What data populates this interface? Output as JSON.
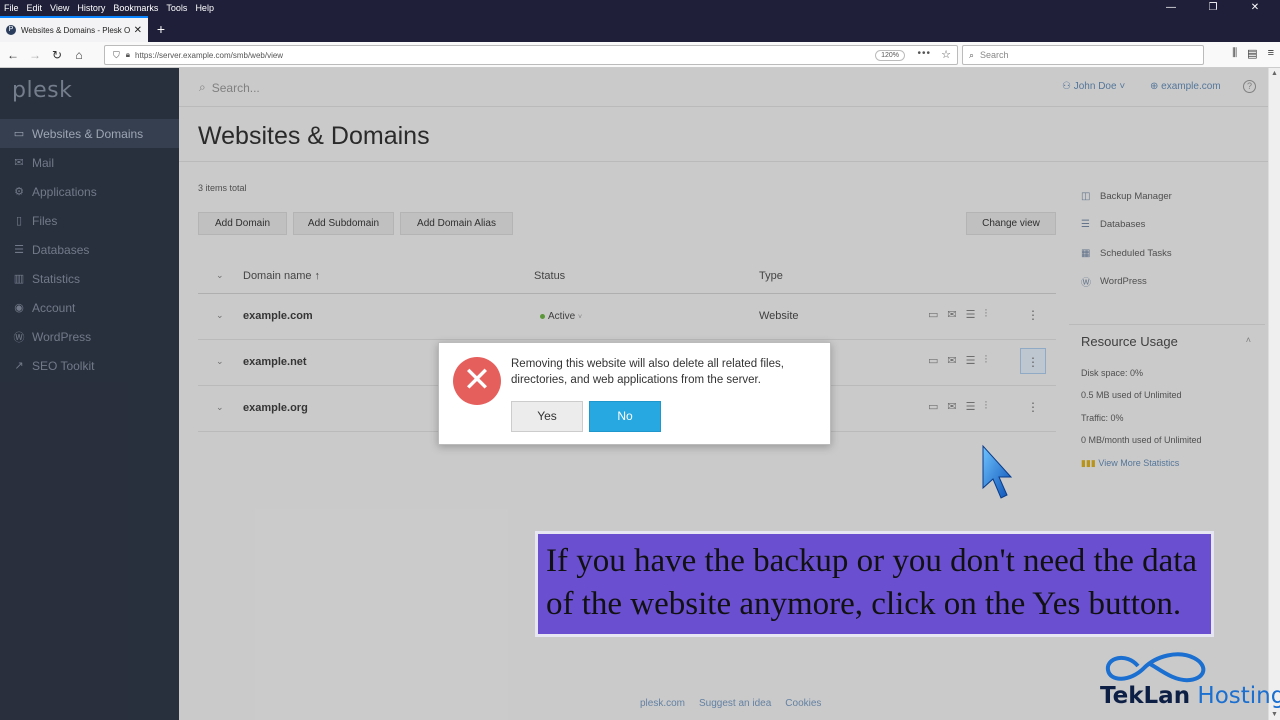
{
  "browser": {
    "menu": [
      "File",
      "Edit",
      "View",
      "History",
      "Bookmarks",
      "Tools",
      "Help"
    ],
    "tab_title": "Websites & Domains - Plesk O",
    "favicon": "P",
    "url": "https://server.example.com/smb/web/view",
    "zoom": "120%",
    "search_placeholder": "Search"
  },
  "sidebar": {
    "logo": "plesk",
    "items": [
      {
        "label": "Websites & Domains",
        "icon": "monitor-icon",
        "active": true
      },
      {
        "label": "Mail",
        "icon": "mail-icon"
      },
      {
        "label": "Applications",
        "icon": "gear-icon"
      },
      {
        "label": "Files",
        "icon": "file-icon"
      },
      {
        "label": "Databases",
        "icon": "database-icon"
      },
      {
        "label": "Statistics",
        "icon": "chart-icon"
      },
      {
        "label": "Account",
        "icon": "account-icon"
      },
      {
        "label": "WordPress",
        "icon": "wordpress-icon"
      },
      {
        "label": "SEO Toolkit",
        "icon": "seo-icon"
      }
    ]
  },
  "topbar": {
    "search_placeholder": "Search...",
    "user": "John Doe",
    "domain": "example.com"
  },
  "page": {
    "title": "Websites & Domains",
    "items_total": "3 items total",
    "buttons": {
      "add_domain": "Add Domain",
      "add_subdomain": "Add Subdomain",
      "add_alias": "Add Domain Alias",
      "change_view": "Change view"
    },
    "columns": {
      "name": "Domain name ↑",
      "status": "Status",
      "type": "Type"
    },
    "rows": [
      {
        "name": "example.com",
        "status": "Active",
        "type": "Website"
      },
      {
        "name": "example.net"
      },
      {
        "name": "example.org"
      }
    ]
  },
  "right_panel": {
    "links": [
      {
        "label": "Backup Manager",
        "icon": "backup-icon"
      },
      {
        "label": "Databases",
        "icon": "database-icon"
      },
      {
        "label": "Scheduled Tasks",
        "icon": "calendar-icon"
      },
      {
        "label": "WordPress",
        "icon": "wordpress-icon"
      }
    ],
    "resource": {
      "title": "Resource Usage",
      "disk": "Disk space: 0%",
      "disk_used": "0.5 MB used of Unlimited",
      "traffic": "Traffic: 0%",
      "traffic_used": "0 MB/month used of Unlimited",
      "more_stats": "View More Statistics"
    }
  },
  "footer": {
    "links": [
      "plesk.com",
      "Suggest an idea",
      "Cookies"
    ]
  },
  "dialog": {
    "message": "Removing this website will also delete all related files, directories, and web applications from the server.",
    "yes": "Yes",
    "no": "No"
  },
  "caption": "If you have the backup or you don't need the data of the website anymore, click on the Yes button.",
  "watermark": {
    "part1": "TekLan",
    "part2": " Hosting"
  },
  "colors": {
    "dialog_no_button": "#28a8e0",
    "error_icon": "#e5605d",
    "caption_bg": "#6a4fd0",
    "sidebar_bg": "#2c3342"
  }
}
